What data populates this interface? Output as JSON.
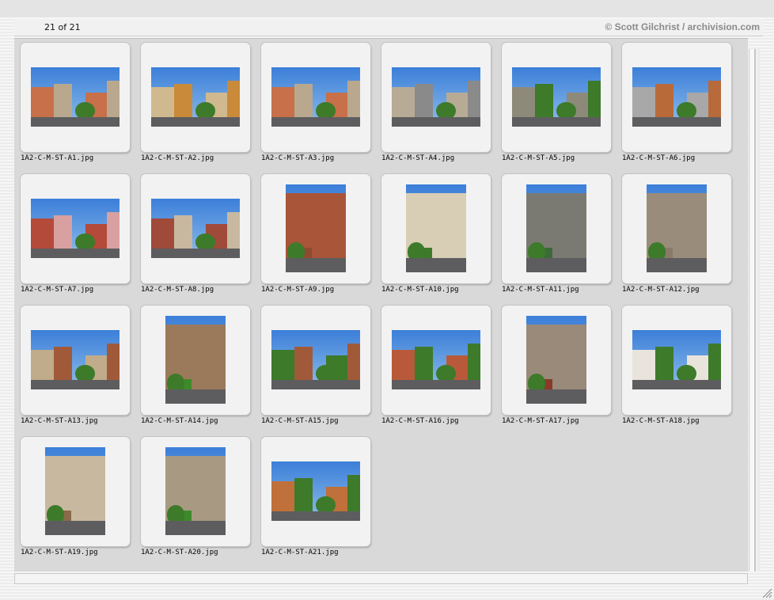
{
  "header": {
    "counter": "21 of 21",
    "credit": "© Scott Gilchrist / archivision.com"
  },
  "icons": {
    "resize": "resize-grip-icon"
  },
  "images": [
    {
      "name": "1A2-C-M-ST-A1.jpg",
      "orientation": "landscape",
      "palette": [
        "#c7704a",
        "#b9a88e"
      ]
    },
    {
      "name": "1A2-C-M-ST-A2.jpg",
      "orientation": "landscape",
      "palette": [
        "#d0b98e",
        "#c98a3a"
      ]
    },
    {
      "name": "1A2-C-M-ST-A3.jpg",
      "orientation": "landscape",
      "palette": [
        "#c7704a",
        "#b9a88e"
      ]
    },
    {
      "name": "1A2-C-M-ST-A4.jpg",
      "orientation": "landscape",
      "palette": [
        "#b8ab96",
        "#8a8a8a"
      ]
    },
    {
      "name": "1A2-C-M-ST-A5.jpg",
      "orientation": "landscape",
      "palette": [
        "#8e8a7a",
        "#3d7a2a"
      ]
    },
    {
      "name": "1A2-C-M-ST-A6.jpg",
      "orientation": "landscape",
      "palette": [
        "#a8a8a8",
        "#b86a3a"
      ]
    },
    {
      "name": "1A2-C-M-ST-A7.jpg",
      "orientation": "landscape",
      "palette": [
        "#b34a3a",
        "#d8a0a0"
      ]
    },
    {
      "name": "1A2-C-M-ST-A8.jpg",
      "orientation": "landscape",
      "palette": [
        "#a04a3a",
        "#c8b8a0"
      ]
    },
    {
      "name": "1A2-C-M-ST-A9.jpg",
      "orientation": "portrait",
      "palette": [
        "#a8553a",
        "#8f4a32"
      ]
    },
    {
      "name": "1A2-C-M-ST-A10.jpg",
      "orientation": "portrait",
      "palette": [
        "#d8cdb5",
        "#3d7a2a"
      ]
    },
    {
      "name": "1A2-C-M-ST-A11.jpg",
      "orientation": "portrait",
      "palette": [
        "#7a7a72",
        "#3d6a3a"
      ]
    },
    {
      "name": "1A2-C-M-ST-A12.jpg",
      "orientation": "portrait",
      "palette": [
        "#9a8c7a",
        "#8a7a6a"
      ]
    },
    {
      "name": "1A2-C-M-ST-A13.jpg",
      "orientation": "landscape",
      "palette": [
        "#c0ab8a",
        "#a05a3a"
      ]
    },
    {
      "name": "1A2-C-M-ST-A14.jpg",
      "orientation": "portrait",
      "palette": [
        "#9a7a5a",
        "#3d8a2a"
      ]
    },
    {
      "name": "1A2-C-M-ST-A15.jpg",
      "orientation": "landscape",
      "palette": [
        "#3d7a2a",
        "#a05a3a"
      ]
    },
    {
      "name": "1A2-C-M-ST-A16.jpg",
      "orientation": "landscape",
      "palette": [
        "#b85a3a",
        "#3d7a2a"
      ]
    },
    {
      "name": "1A2-C-M-ST-A17.jpg",
      "orientation": "portrait",
      "palette": [
        "#9a8a7a",
        "#8a3a2a"
      ]
    },
    {
      "name": "1A2-C-M-ST-A18.jpg",
      "orientation": "landscape",
      "palette": [
        "#e8e4dc",
        "#3d7a2a"
      ]
    },
    {
      "name": "1A2-C-M-ST-A19.jpg",
      "orientation": "portrait",
      "palette": [
        "#c8b8a0",
        "#8a6a4a"
      ]
    },
    {
      "name": "1A2-C-M-ST-A20.jpg",
      "orientation": "portrait",
      "palette": [
        "#a89a82",
        "#3d8a2a"
      ]
    },
    {
      "name": "1A2-C-M-ST-A21.jpg",
      "orientation": "landscape",
      "palette": [
        "#c0703a",
        "#3d7a2a"
      ]
    }
  ]
}
